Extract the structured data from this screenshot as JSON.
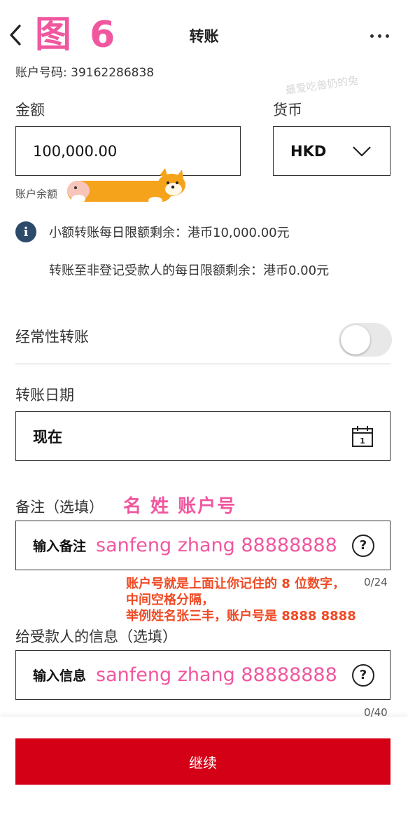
{
  "header": {
    "back_icon": "chevron-left-icon",
    "figure_label": "图 6",
    "title": "转账",
    "more_icon": "more-dots-icon"
  },
  "account": {
    "line": "账户号码: 39162286838"
  },
  "watermark": "最爱吃兽奶的兔",
  "amount": {
    "label": "金额",
    "value": "100,000.00",
    "balance_label": "账户余额"
  },
  "currency": {
    "label": "货币",
    "selected": "HKD",
    "dropdown_icon": "chevron-down-icon"
  },
  "limits": {
    "info_icon": "info-icon",
    "small_transfer": "小额转账每日限额剩余：港币10,000.00元",
    "unregistered_payee": "转账至非登记受款人的每日限额剩余：港币0.00元"
  },
  "recurring": {
    "label": "经常性转账",
    "enabled": false
  },
  "date": {
    "label": "转账日期",
    "value": "现在",
    "calendar_icon": "calendar-icon",
    "calendar_day": "1"
  },
  "remark": {
    "label": "备注（选填）",
    "annotation": "名 姓 账户号",
    "placeholder": "输入备注",
    "typed_text": "sanfeng zhang 88888888",
    "help_icon": "question-icon",
    "counter": "0/24",
    "note_lines": [
      "账户号就是上面让你记住的 8 位数字，",
      "中间空格分隔，",
      "举例姓名张三丰，账户号是 8888 8888"
    ]
  },
  "message": {
    "label": "给受款人的信息（选填）",
    "placeholder": "输入信息",
    "typed_text": "sanfeng zhang 88888888",
    "help_icon": "question-icon",
    "counter": "0/40"
  },
  "footer": {
    "continue_label": "继续"
  },
  "colors": {
    "brand_red": "#d40016",
    "annotation_pink": "#f0579f",
    "annotation_red": "#ef4a24",
    "info_blue": "#2d4a6b"
  }
}
